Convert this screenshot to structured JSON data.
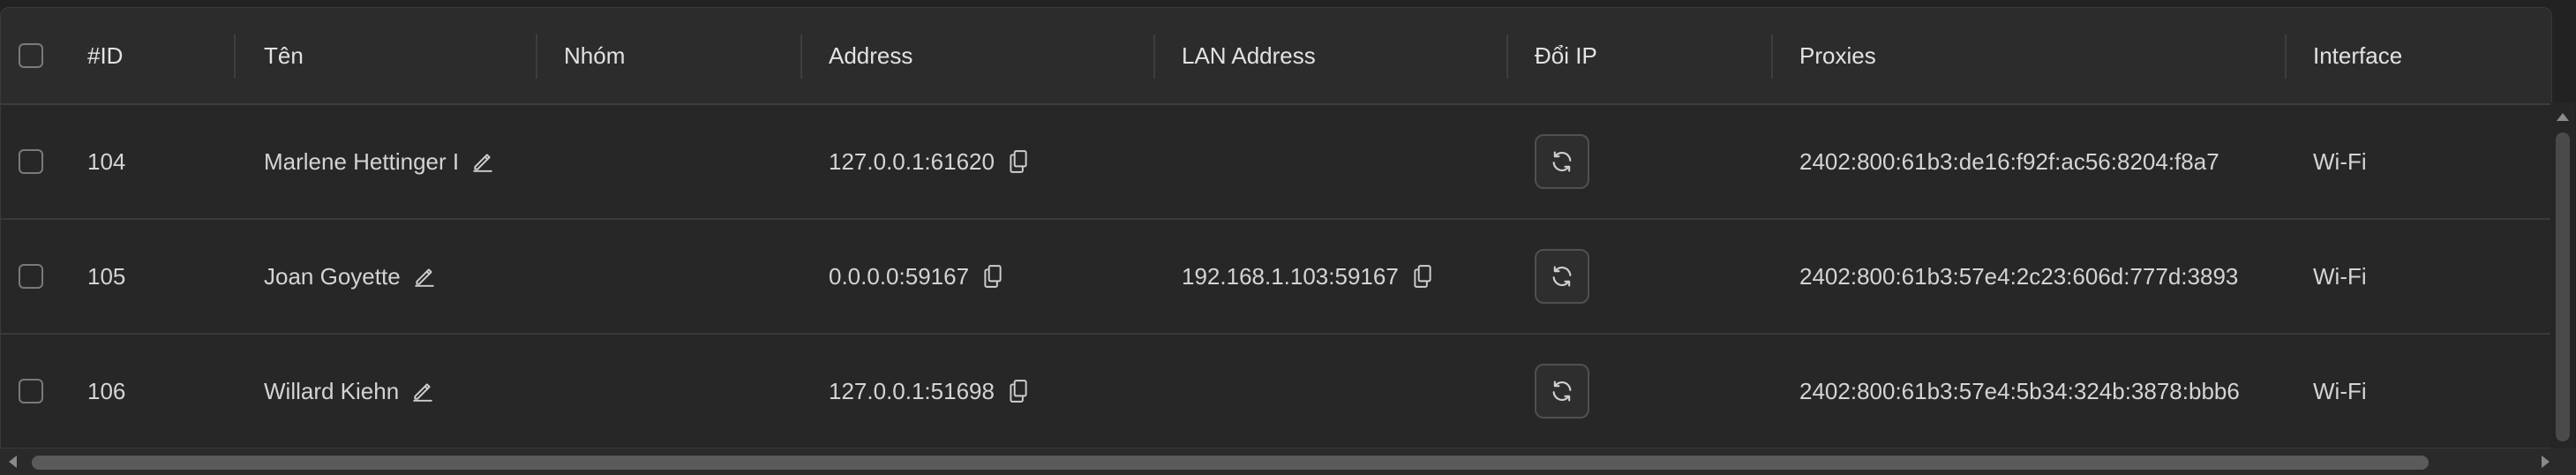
{
  "columns": {
    "id": "#ID",
    "name": "Tên",
    "group": "Nhóm",
    "address": "Address",
    "lan_address": "LAN Address",
    "change_ip": "Đổi IP",
    "proxies": "Proxies",
    "interface": "Interface"
  },
  "rows": [
    {
      "id": "104",
      "name": "Marlene Hettinger I",
      "group": "",
      "address": "127.0.0.1:61620",
      "lan_address": "",
      "proxies": "2402:800:61b3:de16:f92f:ac56:8204:f8a7",
      "interface": "Wi-Fi"
    },
    {
      "id": "105",
      "name": "Joan Goyette",
      "group": "",
      "address": "0.0.0.0:59167",
      "lan_address": "192.168.1.103:59167",
      "proxies": "2402:800:61b3:57e4:2c23:606d:777d:3893",
      "interface": "Wi-Fi"
    },
    {
      "id": "106",
      "name": "Willard Kiehn",
      "group": "",
      "address": "127.0.0.1:51698",
      "lan_address": "",
      "proxies": "2402:800:61b3:57e4:5b34:324b:3878:bbb6",
      "interface": "Wi-Fi"
    }
  ],
  "icons": {
    "edit": "pencil-icon",
    "copy": "copy-icon",
    "change_ip": "refresh-icon"
  },
  "colors": {
    "background": "#282828",
    "header": "#2c2c2c",
    "text": "#d4d4d4",
    "border": "#3a3a3a"
  }
}
